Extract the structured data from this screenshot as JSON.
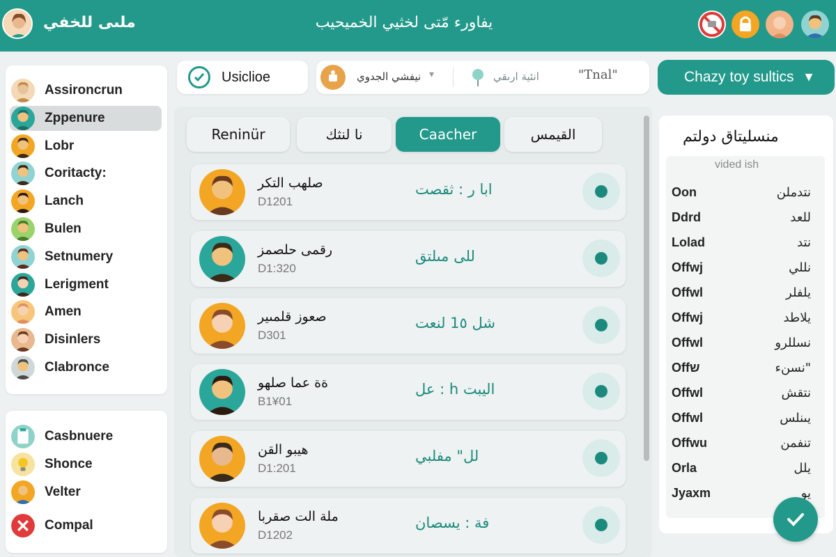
{
  "header": {
    "user_name": "ملىى للخفي",
    "title": "يفاورء مّتى لخثيي الخميحيب",
    "icons": [
      "no-entry-icon",
      "lock-badge-icon",
      "profile-icon",
      "avatar-icon"
    ]
  },
  "sidebar": {
    "items": [
      {
        "label": "Assironcrun",
        "icon": "avatar-icon",
        "active": false
      },
      {
        "label": "Zppenure",
        "icon": "avatar-icon",
        "active": true
      },
      {
        "label": "Lobr",
        "icon": "avatar-icon",
        "active": false
      },
      {
        "label": "Coritacty:",
        "icon": "avatar-icon",
        "active": false
      },
      {
        "label": "Lanch",
        "icon": "avatar-icon",
        "active": false
      },
      {
        "label": "Bulen",
        "icon": "avatar-icon",
        "active": false
      },
      {
        "label": "Setnumery",
        "icon": "avatar-icon",
        "active": false
      },
      {
        "label": "Lerigment",
        "icon": "avatar-icon",
        "active": false
      },
      {
        "label": "Amen",
        "icon": "avatar-icon",
        "active": false
      },
      {
        "label": "Disinlers",
        "icon": "avatar-icon",
        "active": false
      },
      {
        "label": "Clabronce",
        "icon": "avatar-icon",
        "active": false
      }
    ],
    "bottom_items": [
      {
        "label": "Casbnuere",
        "icon": "clipboard-icon"
      },
      {
        "label": "Shonce",
        "icon": "lightbulb-icon"
      },
      {
        "label": "Velter",
        "icon": "avatar-icon"
      },
      {
        "label": "Compal",
        "icon": "close-icon"
      }
    ]
  },
  "toolbar": {
    "check_label": "Usiclioe",
    "filter_select": "نيفشي الجدوي",
    "filter_option": "انئية ارىقي",
    "filter_more": "\"Tnal\"",
    "dropdown_label": "Chazy toy sultics"
  },
  "tabs": [
    {
      "label": "Reninür",
      "active": false
    },
    {
      "label": "نا لنثك",
      "active": false
    },
    {
      "label": "Caacher",
      "active": true
    },
    {
      "label": "القيمس",
      "active": false
    }
  ],
  "cards": [
    {
      "name": "صلهب التكر",
      "id": "D1201",
      "status": "ابا ر : ثقصت"
    },
    {
      "name": "رقمى حلصمز",
      "id": "D1:320",
      "status": "للى مىلتق"
    },
    {
      "name": "صعوز قلمىير",
      "id": "D301",
      "status": "شل 1٥ لنعت"
    },
    {
      "name": "ةة عما صلهو",
      "id": "B1¥01",
      "status": "عل : h اليبت"
    },
    {
      "name": "هيبو القن",
      "id": "D1:201",
      "status": "لل\" مفلبي"
    },
    {
      "name": "ملة الت صقربا",
      "id": "D1202",
      "status": "فة : يسصان"
    }
  ],
  "details": {
    "title": "منسليتاق دولتم",
    "subtitle": "vided ish",
    "rows": [
      {
        "k": "Oo‌n",
        "v": "نتدملن"
      },
      {
        "k": "Dd‌r‌d",
        "v": "للعد"
      },
      {
        "k": "Lolad",
        "v": "نتد"
      },
      {
        "k": "Offwj",
        "v": "نللي"
      },
      {
        "k": "Offwl",
        "v": "يلفلر"
      },
      {
        "k": "Offwj",
        "v": "يلاطد"
      },
      {
        "k": "Offwl",
        "v": "نسللرو"
      },
      {
        "k": "Offש",
        "v": "نسنء\""
      },
      {
        "k": "Offwl",
        "v": "نتقش"
      },
      {
        "k": "Offwl",
        "v": "يىنلس"
      },
      {
        "k": "Offwu",
        "v": "تنفمن"
      },
      {
        "k": "Orla",
        "v": "يلل"
      },
      {
        "k": "Jyaxm",
        "v": "يو"
      }
    ]
  },
  "colors": {
    "accent": "#22998a",
    "accent_dark": "#1b8a7c",
    "danger": "#e03a3a"
  }
}
